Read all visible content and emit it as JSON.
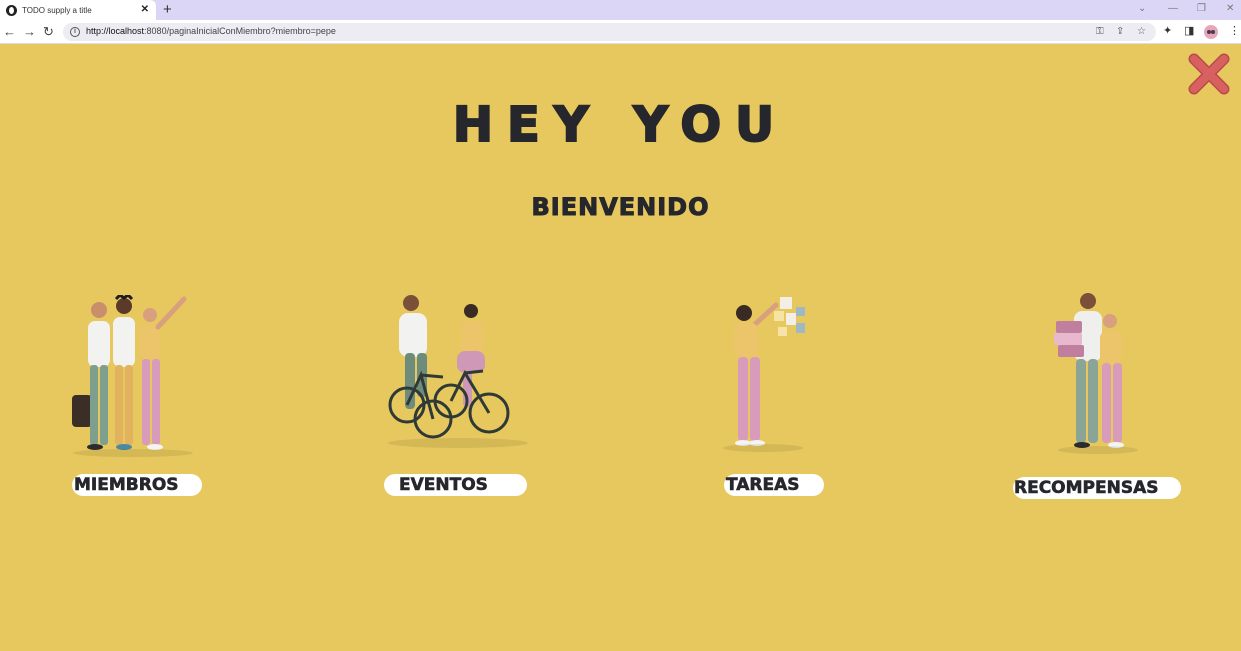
{
  "browser": {
    "tab_title": "TODO supply a title",
    "new_tab": "+",
    "tab_close": "✕",
    "url_host": "http://localhost",
    "url_rest": ":8080/paginaInicialConMiembro?miembro=pepe",
    "icons": [
      "back-arrow-icon",
      "forward-arrow-icon",
      "reload-icon",
      "info-icon",
      "key-icon",
      "share-icon",
      "star-icon",
      "extensions-icon",
      "side-panel-icon",
      "profile-avatar",
      "menu-icon"
    ]
  },
  "page": {
    "background": "#e6c85e",
    "headline": "HEY YOU",
    "subheading": "BIENVENIDO",
    "close_icon": "close-x-icon",
    "sections": [
      {
        "label": "MIEMBROS",
        "illustration": "group-of-friends-illustration"
      },
      {
        "label": "EVENTOS",
        "illustration": "couple-cycling-illustration"
      },
      {
        "label": "TAREAS",
        "illustration": "woman-sticky-notes-illustration"
      },
      {
        "label": "RECOMPENSAS",
        "illustration": "couple-with-gift-boxes-illustration"
      }
    ]
  }
}
